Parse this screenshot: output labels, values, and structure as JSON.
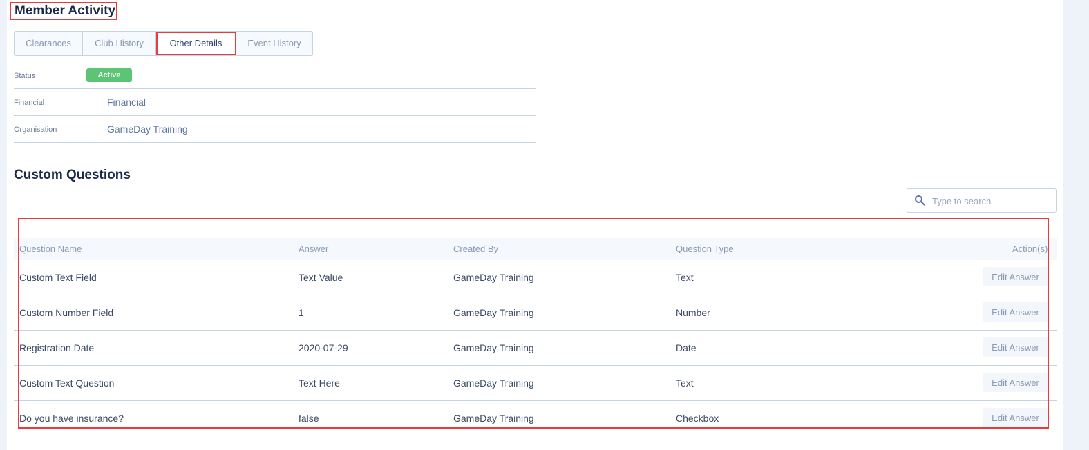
{
  "header": {
    "title": "Member Activity"
  },
  "tabs": [
    {
      "label": "Clearances"
    },
    {
      "label": "Club History"
    },
    {
      "label": "Other Details"
    },
    {
      "label": "Event History"
    }
  ],
  "details": {
    "status_label": "Status",
    "status_value": "Active",
    "financial_label": "Financial",
    "financial_value": "Financial",
    "organisation_label": "Organisation",
    "organisation_value": "GameDay Training"
  },
  "custom_questions": {
    "title": "Custom Questions",
    "search_placeholder": "Type to search",
    "columns": {
      "question_name": "Question Name",
      "answer": "Answer",
      "created_by": "Created By",
      "question_type": "Question Type",
      "actions": "Action(s)"
    },
    "rows": [
      {
        "name": "Custom Text Field",
        "answer": "Text Value",
        "created_by": "GameDay Training",
        "type": "Text",
        "action": "Edit Answer"
      },
      {
        "name": "Custom Number Field",
        "answer": "1",
        "created_by": "GameDay Training",
        "type": "Number",
        "action": "Edit Answer"
      },
      {
        "name": "Registration Date",
        "answer": "2020-07-29",
        "created_by": "GameDay Training",
        "type": "Date",
        "action": "Edit Answer"
      },
      {
        "name": "Custom Text Question",
        "answer": "Text Here",
        "created_by": "GameDay Training",
        "type": "Text",
        "action": "Edit Answer"
      },
      {
        "name": "Do you have insurance?",
        "answer": "false",
        "created_by": "GameDay Training",
        "type": "Checkbox",
        "action": "Edit Answer"
      }
    ]
  },
  "colors": {
    "accent": "#2d4373",
    "status_active": "#5cc575",
    "highlight": "#e83b3b"
  },
  "icons": {
    "search": "search-icon"
  }
}
